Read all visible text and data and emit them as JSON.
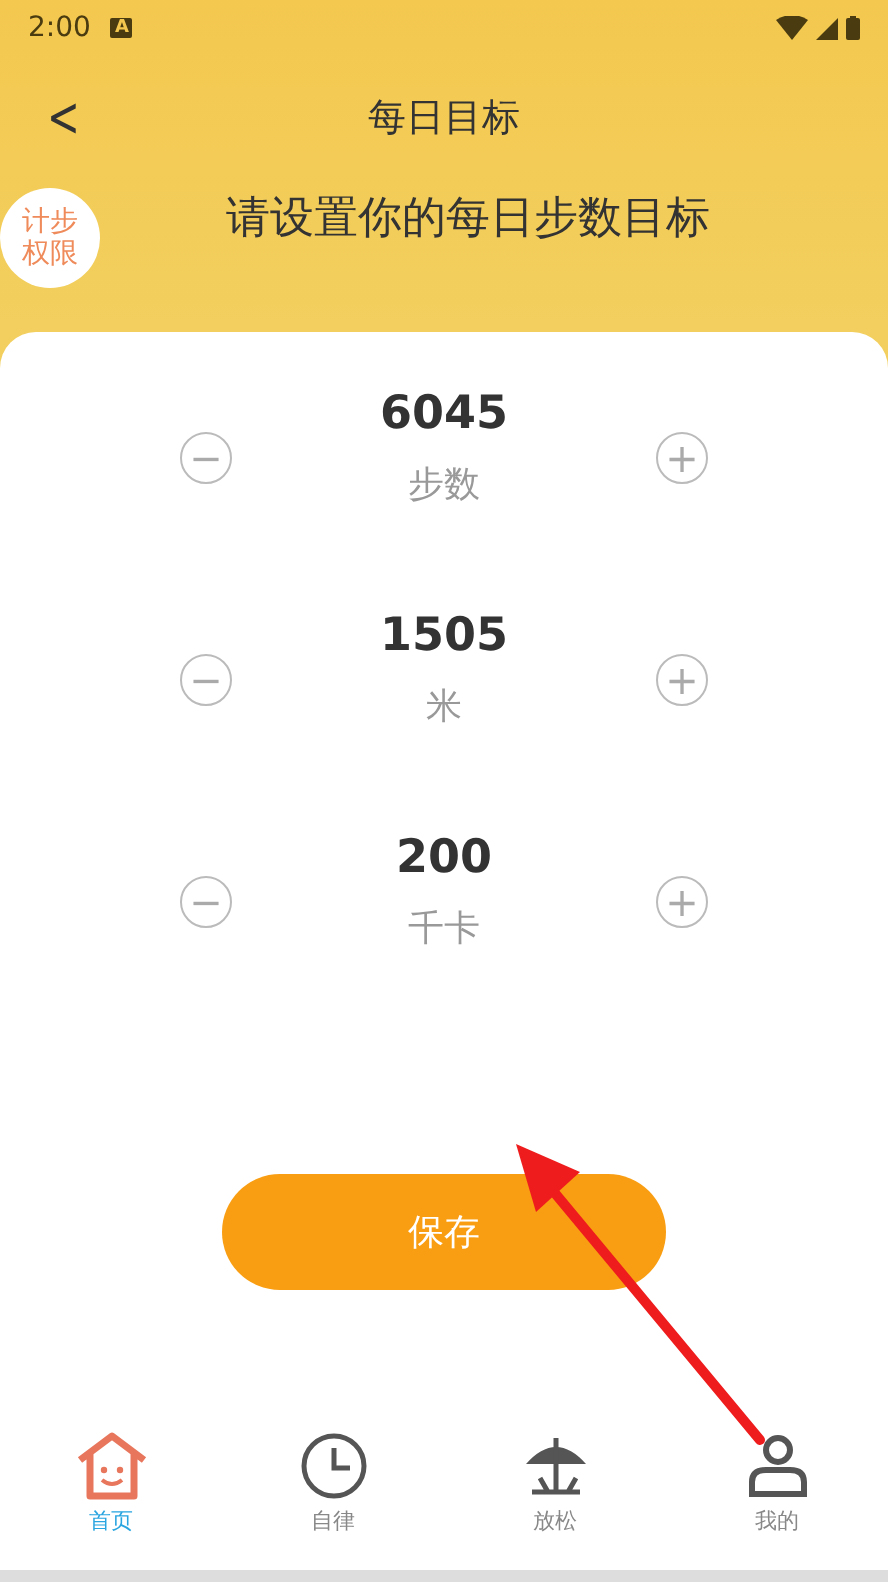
{
  "status_bar": {
    "time": "2:00",
    "badge": "A"
  },
  "header": {
    "back": "<",
    "title": "每日目标",
    "subtitle": "请设置你的每日步数目标",
    "permission_badge": [
      "计步",
      "权限"
    ]
  },
  "goals": [
    {
      "minus": "−",
      "value": "6045",
      "unit": "步数",
      "plus": "+"
    },
    {
      "minus": "−",
      "value": "1505",
      "unit": "米",
      "plus": "+"
    },
    {
      "minus": "−",
      "value": "200",
      "unit": "千卡",
      "plus": "+"
    }
  ],
  "save_button": "保存",
  "tab_bar": [
    {
      "kind": "home",
      "label": "首页",
      "selected": true
    },
    {
      "kind": "clock",
      "label": "自律",
      "selected": false
    },
    {
      "kind": "umbrella",
      "label": "放松",
      "selected": false
    },
    {
      "kind": "person",
      "label": "我的",
      "selected": false
    }
  ]
}
